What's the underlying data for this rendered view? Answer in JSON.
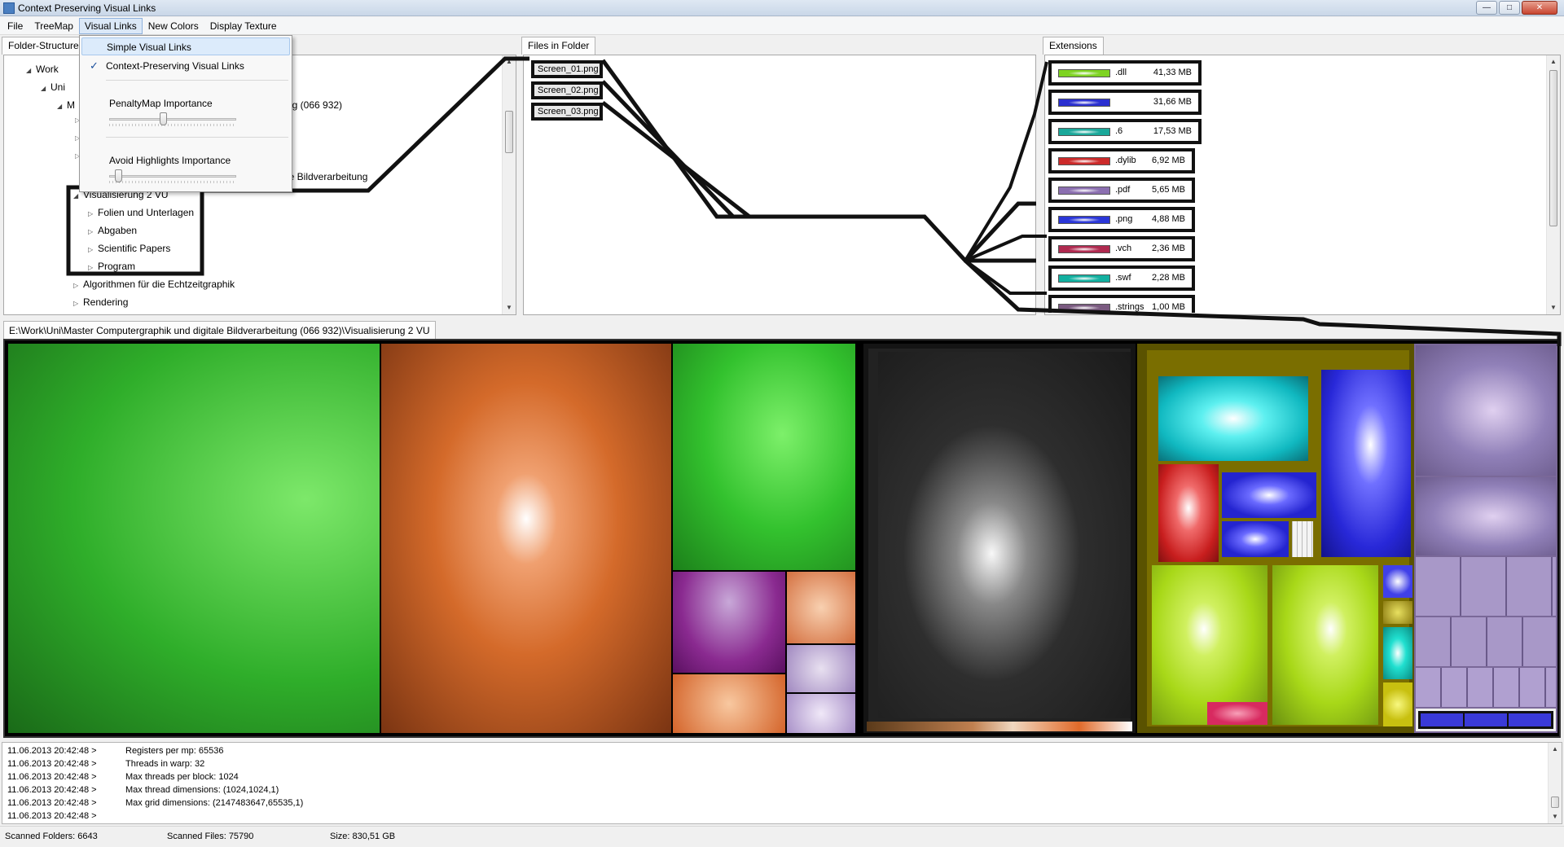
{
  "window": {
    "title": "Context Preserving Visual Links"
  },
  "menubar": [
    "File",
    "TreeMap",
    "Visual Links",
    "New Colors",
    "Display Texture"
  ],
  "visual_links_menu": {
    "simple": "Simple Visual Links",
    "context": "Context-Preserving Visual Links",
    "penalty_label": "PenaltyMap Importance",
    "penalty_value": 0.42,
    "avoid_label": "Avoid Highlights Importance",
    "avoid_value": 0.05
  },
  "tabs": {
    "folders": "Folder-Structure",
    "files": "Files in Folder",
    "extensions": "Extensions"
  },
  "tree": [
    {
      "label": "Work",
      "arrow": "◢"
    },
    {
      "label": "Uni",
      "arrow": "◢"
    },
    {
      "label": "M",
      "arrow": "◢"
    },
    {
      "label": "ng (066 932)"
    },
    {
      "label": "le Bildverarbeitung"
    },
    {
      "label": "Visualisierung 2 VU",
      "arrow": "◢"
    },
    {
      "label": "Folien und Unterlagen",
      "arrow": "▷"
    },
    {
      "label": "Abgaben",
      "arrow": "▷"
    },
    {
      "label": "Scientific Papers",
      "arrow": "▷"
    },
    {
      "label": "Program",
      "arrow": "▷"
    },
    {
      "label": "Algorithmen für die Echtzeitgraphik",
      "arrow": "▷"
    },
    {
      "label": "Rendering",
      "arrow": "▷"
    }
  ],
  "files": [
    "Screen_01.png",
    "Screen_02.png",
    "Screen_03.png"
  ],
  "extensions": [
    {
      "name": ".dll",
      "size": "41,33 MB",
      "color": "#7ed321"
    },
    {
      "name": "",
      "size": "31,66 MB",
      "color": "#2a2fd0"
    },
    {
      "name": ".6",
      "size": "17,53 MB",
      "color": "#1aa89a"
    },
    {
      "name": ".dylib",
      "size": "6,92 MB",
      "color": "#cc2a2a"
    },
    {
      "name": ".pdf",
      "size": "5,65 MB",
      "color": "#8b6fb0"
    },
    {
      "name": ".png",
      "size": "4,88 MB",
      "color": "#2a36d8"
    },
    {
      "name": ".vch",
      "size": "2,36 MB",
      "color": "#b02a50"
    },
    {
      "name": ".swf",
      "size": "2,28 MB",
      "color": "#12b0a0"
    },
    {
      "name": ".strings",
      "size": "1,00 MB",
      "color": "#7a5a80"
    }
  ],
  "path": "E:\\Work\\Uni\\Master Computergraphik und digitale Bildverarbeitung (066 932)\\Visualisierung 2 VU",
  "log": [
    {
      "ts": "11.06.2013 20:42:48 >",
      "msg": "Registers per mp:  65536"
    },
    {
      "ts": "11.06.2013 20:42:48 >",
      "msg": "Threads in warp:  32"
    },
    {
      "ts": "11.06.2013 20:42:48 >",
      "msg": "Max threads per block:  1024"
    },
    {
      "ts": "11.06.2013 20:42:48 >",
      "msg": "Max thread dimensions:  (1024,1024,1)"
    },
    {
      "ts": "11.06.2013 20:42:48 >",
      "msg": "Max grid dimensions:  (2147483647,65535,1)"
    },
    {
      "ts": "11.06.2013 20:42:48 >",
      "msg": ""
    }
  ],
  "status": {
    "folders": "Scanned Folders: 6643",
    "files": "Scanned Files: 75790",
    "size": "Size: 830,51 GB"
  },
  "icons": [
    "check-icon",
    "expand-arrow-icon",
    "scroll-arrow-icon",
    "minimize-icon",
    "maximize-icon",
    "close-icon"
  ]
}
